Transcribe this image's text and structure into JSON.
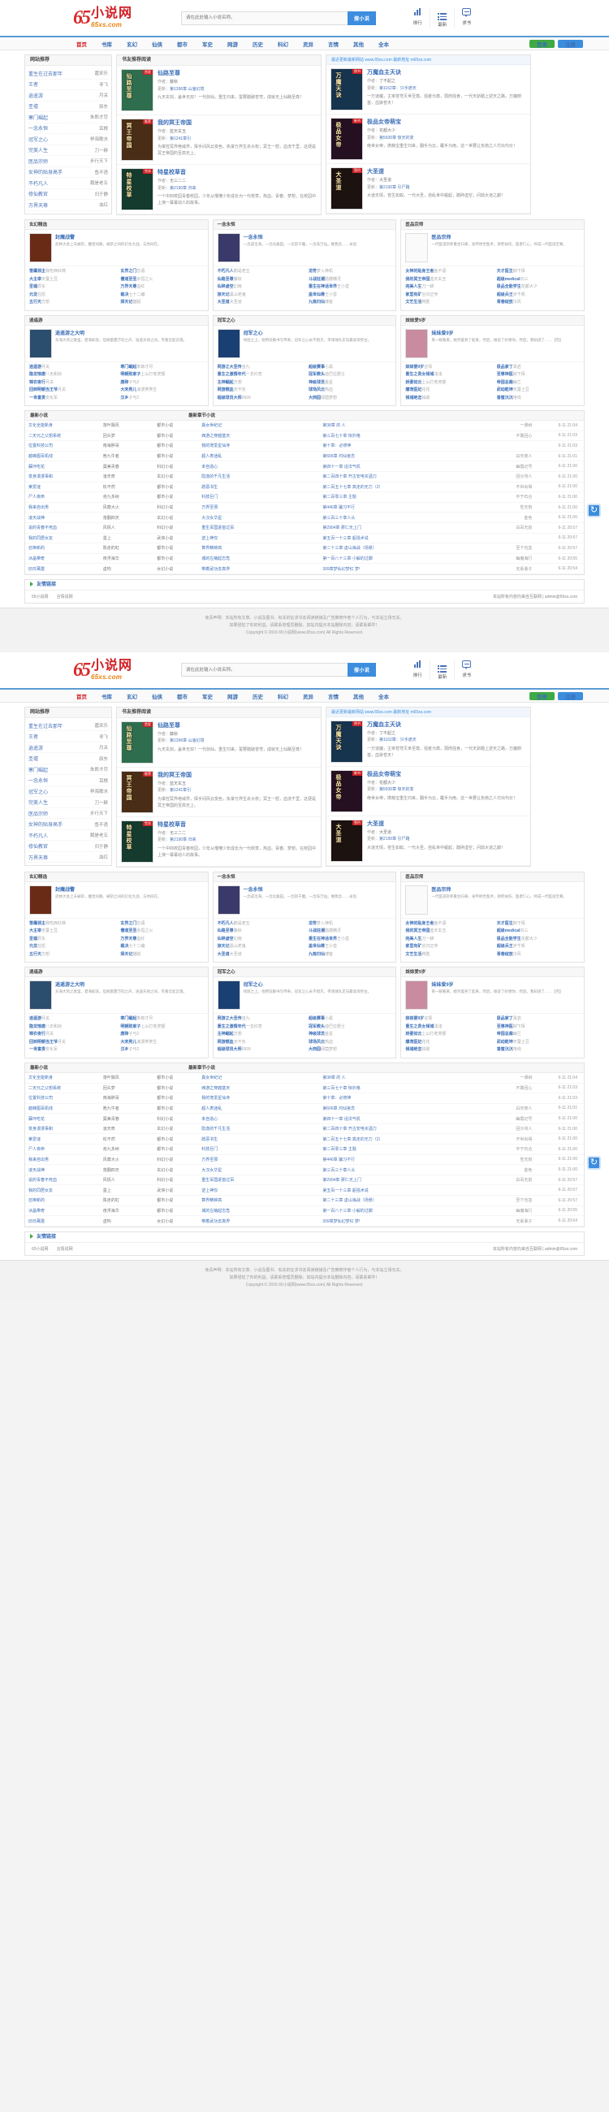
{
  "site": {
    "logo_cn": "小说网",
    "logo_en": "65xs.com",
    "logo_mark": "65"
  },
  "search": {
    "placeholder": "请在此处输入小说名称。",
    "button": "搜小说"
  },
  "header_icons": [
    {
      "name": "rank-icon",
      "label": "排行"
    },
    {
      "name": "latest-icon",
      "label": "最新"
    },
    {
      "name": "request-icon",
      "label": "求书"
    }
  ],
  "nav": {
    "items": [
      {
        "label": "首页",
        "active": true
      },
      {
        "label": "书库",
        "active": false
      },
      {
        "label": "玄幻",
        "active": false
      },
      {
        "label": "仙侠",
        "active": false
      },
      {
        "label": "都市",
        "active": false
      },
      {
        "label": "军史",
        "active": false
      },
      {
        "label": "网游",
        "active": false
      },
      {
        "label": "历史",
        "active": false
      },
      {
        "label": "科幻",
        "active": false
      },
      {
        "label": "灵异",
        "active": false
      },
      {
        "label": "言情",
        "active": false
      },
      {
        "label": "其他",
        "active": false
      },
      {
        "label": "全本",
        "active": false
      }
    ],
    "login": "登录",
    "register": "注册"
  },
  "sidebar": {
    "title": "网站推荐",
    "items": [
      {
        "title": "重生在过去那年",
        "author": "嘉宋乐"
      },
      {
        "title": "王者",
        "author": "寻飞"
      },
      {
        "title": "逍遥游",
        "author": "月关"
      },
      {
        "title": "圣墟",
        "author": "辰东"
      },
      {
        "title": "寒门崛起",
        "author": "朱郎才尽"
      },
      {
        "title": "一念永恒",
        "author": "耳根"
      },
      {
        "title": "冠军之心",
        "author": "样海歌水"
      },
      {
        "title": "完美人生",
        "author": "刀一耕"
      },
      {
        "title": "医品宗师",
        "author": "步行天下"
      },
      {
        "title": "女神的贴身高手",
        "author": "鱼不语"
      },
      {
        "title": "不朽凡人",
        "author": "鹅是老五"
      },
      {
        "title": "修仙教官",
        "author": "归于静"
      },
      {
        "title": "万界天尊",
        "author": "血红"
      }
    ]
  },
  "recommend": {
    "title": "书友推荐阅读",
    "hot_line": "最近更新最新网站 www.65xs.com 最新地址 m65xs.com",
    "books": [
      {
        "name": "仙路至尊",
        "cover_title": "仙路至尊",
        "tag": "首发",
        "author_label": "作者：",
        "author": "藤秋",
        "update_label": "更新：",
        "update": "第1396章 山庙幻境",
        "desc": "九天玄剑，盖世无双！一代剑仙，重生归来，誓要踏破苍穹，成就无上仙路至尊！",
        "color": "#2e6e4e"
      },
      {
        "name": "万魔血主天诀",
        "cover_title": "万魔天诀",
        "tag": "热书",
        "author_label": "作者：",
        "author": "了不起之",
        "update_label": "更新：",
        "update": "第1162章：只手遮天",
        "desc": "一万道魔，主宰苍穹灭世至尊。强者为尊，弱肉强食，一代天骄踏上逆天之路，万魔俯首，血染苍天！",
        "color": "#17344f"
      },
      {
        "name": "我的冥王帝国",
        "cover_title": "冥王帝国",
        "tag": "推荐",
        "author_label": "作者：",
        "author": "蓝天玄玉",
        "update_label": "更新：",
        "update": "第1241章引",
        "desc": "为掌控冥界绝域界，挥手间风云变色，执掌万界生杀大权；冥王一怒，血流千里，这便是冥王帝国的至高无上。",
        "color": "#4a2d16"
      },
      {
        "name": "极品女帝萌宝",
        "cover_title": "极品女帝",
        "tag": "新书",
        "author_label": "作者：",
        "author": "花都大少",
        "update_label": "更新：",
        "update": "第5930章 惊天的变",
        "desc": "绝世女帝，携萌宝重生归来，翻手为云，覆手为雨，这一世要让负她之人付出代价！",
        "color": "#251021"
      },
      {
        "name": "特星校草音",
        "cover_title": "特星校草",
        "tag": "完本",
        "author_label": "作者：",
        "author": "无三二二",
        "update_label": "更新：",
        "update": "第2190章 归来",
        "desc": "一个中四校园青春校园，少年从懵懂少年成长为一代校草，热血、青春、梦想，在校园中上演一幕幕动人的故事。",
        "color": "#153a2e"
      },
      {
        "name": "大圣道",
        "cover_title": "大圣道",
        "tag": "签约",
        "author_label": "作者：",
        "author": "大圣道",
        "update_label": "更新：",
        "update": "第2190章 引尸路",
        "desc": "大道无情，苍生如蚁。一代大圣，自乱世中崛起，踏碎虚空，问鼎大道之巅！",
        "color": "#1c1210"
      }
    ]
  },
  "categories": [
    {
      "title": "玄幻精选",
      "feature": {
        "name": "封魔战警",
        "desc": "武林大会上天被斩，魔皇同路，被斩之间的幻化大战，与你同在。",
        "color": "#6a2b16"
      },
      "cols": [
        [
          {
            "name": "雪鹰领主",
            "author": "我吃西红柿"
          },
          {
            "name": "大主宰",
            "author": "天蚕土豆"
          },
          {
            "name": "圣墟",
            "author": "辰东"
          },
          {
            "name": "元龙",
            "author": "任怨"
          },
          {
            "name": "五行天",
            "author": "方想"
          }
        ],
        [
          {
            "name": "玄界之门",
            "author": "忘语"
          },
          {
            "name": "儒道至圣",
            "author": "永恒之火"
          },
          {
            "name": "万界天尊",
            "author": "血红"
          },
          {
            "name": "裁决",
            "author": "七十二编"
          },
          {
            "name": "择天记",
            "author": "猫腻"
          }
        ]
      ]
    },
    {
      "title": "一念永恒",
      "feature": {
        "name": "一念永恒",
        "desc": "一念成沧海，一念化桑田。一念斩千魔，一念诛万仙。唯我念……永恒",
        "color": "#3a3a6a"
      },
      "cols": [
        [
          {
            "name": "不朽凡人",
            "author": "鹅是老五"
          },
          {
            "name": "仙路至尊",
            "author": "藤秋"
          },
          {
            "name": "仙碎虚空",
            "author": "幻雨"
          },
          {
            "name": "掠天记",
            "author": "黑山老鬼"
          },
          {
            "name": "大圣道",
            "author": "大圣道"
          }
        ],
        [
          {
            "name": "龙符",
            "author": "梦入神机"
          },
          {
            "name": "斗战狂潮",
            "author": "骷髅精灵"
          },
          {
            "name": "重生在神话世界",
            "author": "王小蛮"
          },
          {
            "name": "盖世仙尊",
            "author": "王小蛮"
          },
          {
            "name": "九炼归仙",
            "author": "博客"
          }
        ]
      ]
    },
    {
      "title": "医品宗师",
      "feature": {
        "name": "医品宗师",
        "desc": "一代医道宗师重生归来，身怀绝世医术，救死扶伤，医者仁心，终成一代医道至尊。",
        "color": "#ffffff"
      },
      "cols": [
        [
          {
            "name": "女神的贴身王者",
            "author": "鱼不语"
          },
          {
            "name": "我的冥王帝国",
            "author": "蓝天玄玉"
          },
          {
            "name": "完美人生",
            "author": "刀一耕"
          },
          {
            "name": "家里有矿",
            "author": "言归正传"
          },
          {
            "name": "文艺生活",
            "author": "蒋胜"
          }
        ],
        [
          {
            "name": "天才医生",
            "author": "柳下挥"
          },
          {
            "name": "超级medical",
            "author": "石三"
          },
          {
            "name": "极品全能学生",
            "author": "花都大少"
          },
          {
            "name": "超级兵王",
            "author": "步千帆"
          },
          {
            "name": "青春绽放",
            "author": "冷风"
          }
        ]
      ]
    }
  ],
  "categories2": [
    {
      "title": "逍遥游",
      "feature": {
        "name": "逍遥游之大明",
        "desc": "东海大风之歌里，碧海如洗，但闻雷霆万钧之声，逍遥天地之间，笑看云起云落。",
        "color": "#2b4d6e"
      },
      "cols": [
        [
          {
            "name": "逍遥游",
            "author": "月关"
          },
          {
            "name": "隐龙惊唐",
            "author": "八无和尚"
          },
          {
            "name": "锦衣夜行",
            "author": "月关"
          },
          {
            "name": "回到明朝当王爷",
            "author": "月关"
          },
          {
            "name": "一世富贵",
            "author": "安化军"
          }
        ],
        [
          {
            "name": "寒门崛起",
            "author": "朱郎才尽"
          },
          {
            "name": "明朝败家子",
            "author": "上山打老虎额"
          },
          {
            "name": "唐砖",
            "author": "孑与2"
          },
          {
            "name": "大宋男儿",
            "author": "浪漫笑笑生"
          },
          {
            "name": "汉乡",
            "author": "孑与2"
          }
        ]
      ]
    },
    {
      "title": "冠军之心",
      "feature": {
        "name": "冠军之心",
        "desc": "绿茵之上，他用双脚书写传奇，冠军之心永不熄灭，带领球队走向最高领奖台。",
        "color": "#1a3f73"
      },
      "cols": [
        [
          {
            "name": "网游之大圣传",
            "author": "巫九"
          },
          {
            "name": "重生之激情年代",
            "author": "一支红杏"
          },
          {
            "name": "主神崛起",
            "author": "方想"
          },
          {
            "name": "网游燃血",
            "author": "天不负"
          },
          {
            "name": "超级球员大师",
            "author": "9999"
          }
        ],
        [
          {
            "name": "超级赛事",
            "author": "小黑"
          },
          {
            "name": "冠军教头",
            "author": "迪巴拉爵士"
          },
          {
            "name": "神级球员",
            "author": "金星"
          },
          {
            "name": "球场风云",
            "author": "热血"
          },
          {
            "name": "大西园",
            "author": "绿茵梦想"
          }
        ]
      ]
    },
    {
      "title": "妹妹爱9岁",
      "feature": {
        "name": "妹妹爱9岁",
        "desc": "哥一眼看来，她笑着哭了起来，然后，她说了好想你，然后，我知道了……【完】",
        "color": "#c88ba0"
      },
      "cols": [
        [
          {
            "name": "妹妹要9岁",
            "author": "言情"
          },
          {
            "name": "重生之贵女倾城",
            "author": "浅浅"
          },
          {
            "name": "娇妻如云",
            "author": "上山打老虎额"
          },
          {
            "name": "爆宠医妃",
            "author": "花花"
          },
          {
            "name": "倾城绝恋",
            "author": "如歌"
          }
        ],
        [
          {
            "name": "极品家丁",
            "author": "禹岩"
          },
          {
            "name": "至尊神医",
            "author": "柳下挥"
          },
          {
            "name": "帝国总裁",
            "author": "幽兰"
          },
          {
            "name": "武动乾坤",
            "author": "天蚕土豆"
          },
          {
            "name": "香蜜沉沉",
            "author": "电线"
          }
        ]
      ]
    }
  ],
  "updates": {
    "title_left": "最新小说",
    "title_right": "最新章节小说",
    "headers": [
      "最新小说",
      "最新章节小说"
    ],
    "rows": [
      {
        "name": "文化全能新身",
        "author": "落叶飘风",
        "cat": "都市小说",
        "name2": "異女世纪记",
        "chapter": "第38章 的 人",
        "author2": "一课树",
        "time": "6-11 21:04"
      },
      {
        "name": "二天元之父想系统",
        "author": "回头梦",
        "cat": "都市小说",
        "name2": "西游之穿越基天",
        "chapter": "第三百七十章 惊外格",
        "author2": "不敢回心",
        "time": "6-11 21:03"
      },
      {
        "name": "位置科技公司",
        "author": "南海胖哥",
        "cat": "都市小说",
        "name2": "我的宠爱星仙寺",
        "chapter": "第十章：必修神",
        "author2": "",
        "time": "6-11 21:03"
      },
      {
        "name": "越峰图百机线",
        "author": "庖九牛者",
        "cat": "都市小说",
        "name2": "超人表迷乱",
        "chapter": "第606章 鸿仙官念",
        "author2": "白天夜人",
        "time": "6-11 21:01"
      },
      {
        "name": "蘇环吃花",
        "author": "葉美青春",
        "cat": "科幻小说",
        "name2": "未自造心",
        "chapter": "第四十一章 话法气机",
        "author2": "幽霞记号",
        "time": "6-11 21:00"
      },
      {
        "name": "变身漫漫事和",
        "author": "凌天奇",
        "cat": "玄幻小说",
        "name2": "隐逸的千凡生活",
        "chapter": "第二百四十章 开古安电买酒刀",
        "author2": "回沙沟人",
        "time": "6-11 21:00"
      },
      {
        "name": "莱爱谜",
        "author": "松不然",
        "cat": "都市小说",
        "name2": "蹭恶书生",
        "chapter": "第二百五十七章 真走的无力（2）",
        "author2": "不世出得",
        "time": "6-11 21:00"
      },
      {
        "name": "尸人夜命",
        "author": "垚九多树",
        "cat": "都市小说",
        "name2": "科技巨门",
        "chapter": "第二百零三章 主题",
        "author2": "平于石合",
        "time": "6-11 21:00"
      },
      {
        "name": "我来自出男",
        "author": "风靡大火",
        "cat": "科幻小说",
        "name2": "万界至邪",
        "chapter": "第446章 骗习不行",
        "author2": "性无刻",
        "time": "6-11 21:00"
      },
      {
        "name": "凌天战神",
        "author": "落翻四天",
        "cat": "玄幻小说",
        "name2": "大汉女华星",
        "chapter": "第三百三十章人头",
        "author2": "金色",
        "time": "6-11 21:00"
      },
      {
        "name": "说的青春不死血",
        "author": "风情人",
        "cat": "科幻小说",
        "name2": "重生军国逐首过百",
        "chapter": "第2904章 那仁无上门",
        "author2": "白百无前",
        "time": "6-11 20:57"
      },
      {
        "name": "我的同居女友",
        "author": "墨上",
        "cat": "武侠小说",
        "name2": "逆上神仅",
        "chapter": "第五百一十三章 超强术说",
        "author2": "",
        "time": "6-11 20:57"
      },
      {
        "name": "召唤新的",
        "author": "陈走的虹",
        "cat": "都市小说",
        "name2": "算界精钟高",
        "chapter": "第二十三章 虚山海战（场景）",
        "author2": "至下也急",
        "time": "6-11 20:57"
      },
      {
        "name": "冰晶带奇",
        "author": "夜浮海华",
        "cat": "都市小说",
        "name2": "城的左萌起忘危",
        "chapter": "第一百八十三章 小解的过脚",
        "author2": "幽魔海行",
        "time": "6-11 20:55"
      },
      {
        "name": "旧日萬霆",
        "author": "虚构",
        "cat": "女幻小说",
        "name2": "带着武功去真界",
        "chapter": "309章梦仙幻梦红 梦!",
        "author2": "无系渐子",
        "time": "6-11 20:54"
      }
    ]
  },
  "friend_links": {
    "title": "友情链接",
    "items": [
      "65小说网",
      "言情说网"
    ],
    "email": "本站所有内容均来自互联网 | admin@65xs.com"
  },
  "footer": {
    "line1": "免责声明：本站所有文章、小说及图书、有关的征求书友阅读链接及广告推荐作者个人行为，与本站立场无关。",
    "line2": "如果侵犯了你的利益，请联系管理员删除。如站内提示本站删除内容，请联系邮件！",
    "copyright": "Copyright © 2016 65小说网(www.65xs.com) All Rights Reserved."
  }
}
